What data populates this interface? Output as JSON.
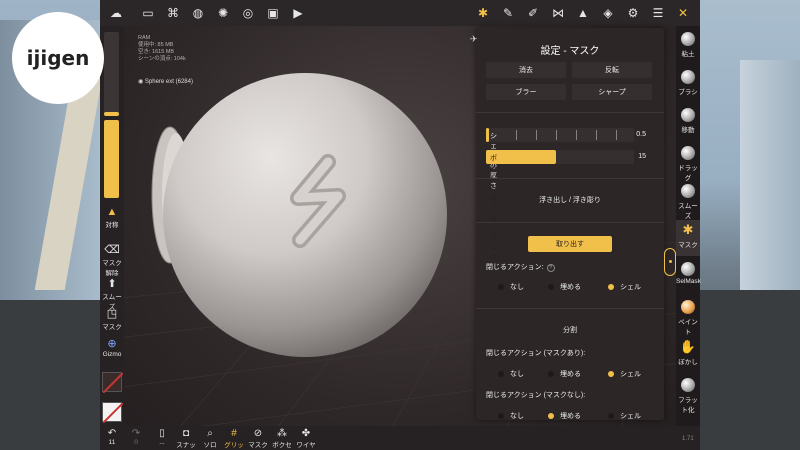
{
  "logo": {
    "text": "ijigen"
  },
  "topbar": {
    "icons": [
      "menu-icon",
      "folder-icon",
      "scene-icon",
      "globe-icon",
      "light-icon",
      "material-icon",
      "image-icon",
      "video-icon"
    ],
    "right_icons": [
      "mask-tool-icon",
      "brush-icon",
      "paint-icon",
      "symmetry-icon",
      "triangle-icon",
      "layers-icon",
      "gear-icon",
      "sliders-icon",
      "tools-toggle-icon"
    ]
  },
  "info": {
    "lines": [
      "RAM",
      "使用中: 85 MB",
      "空き: 1615 MB",
      "シーンの頂点: 104k"
    ],
    "mesh": "Sphere ext (6284)"
  },
  "left": {
    "slider1_fraction": 0.05,
    "slider2_fraction": 1.0,
    "symmetry": "対称",
    "mask_clear": "マスク解除",
    "smooth": "スムーズ",
    "mask": "マスク",
    "gizmo": "Gizmo"
  },
  "bottom": {
    "undo_count": "11",
    "redo_count": "0",
    "items": [
      "...",
      "スナップ",
      "ソロ",
      "グリッド",
      "マスク",
      "ボクセル",
      "ワイヤー"
    ]
  },
  "panel": {
    "title": "設定 - マスク",
    "buttons": {
      "clear": "消去",
      "invert": "反転",
      "blur": "ブラー",
      "sharpen": "シャープ"
    },
    "shell_thickness": {
      "label": "シェルの厚さ",
      "value": "0.5",
      "fraction": 0.02
    },
    "border_smoothing": {
      "label": "ボーダーのスムージング",
      "value": "15",
      "fraction": 0.47
    },
    "emboss": "浮き出し / 浮き彫り",
    "extract": "取り出す",
    "close_action": "閉じるアクション:",
    "options": [
      "なし",
      "埋める",
      "シェル"
    ],
    "split": "分割",
    "close_action_masked": "閉じるアクション (マスクあり):",
    "close_action_unmasked": "閉じるアクション (マスクなし):"
  },
  "right": {
    "tools": [
      "粘土",
      "ブラシ",
      "移動",
      "ドラッグ",
      "スムーズ",
      "マスク",
      "SelMask",
      "ペイント",
      "ぼかし",
      "フラット化"
    ]
  },
  "version": "1.71"
}
